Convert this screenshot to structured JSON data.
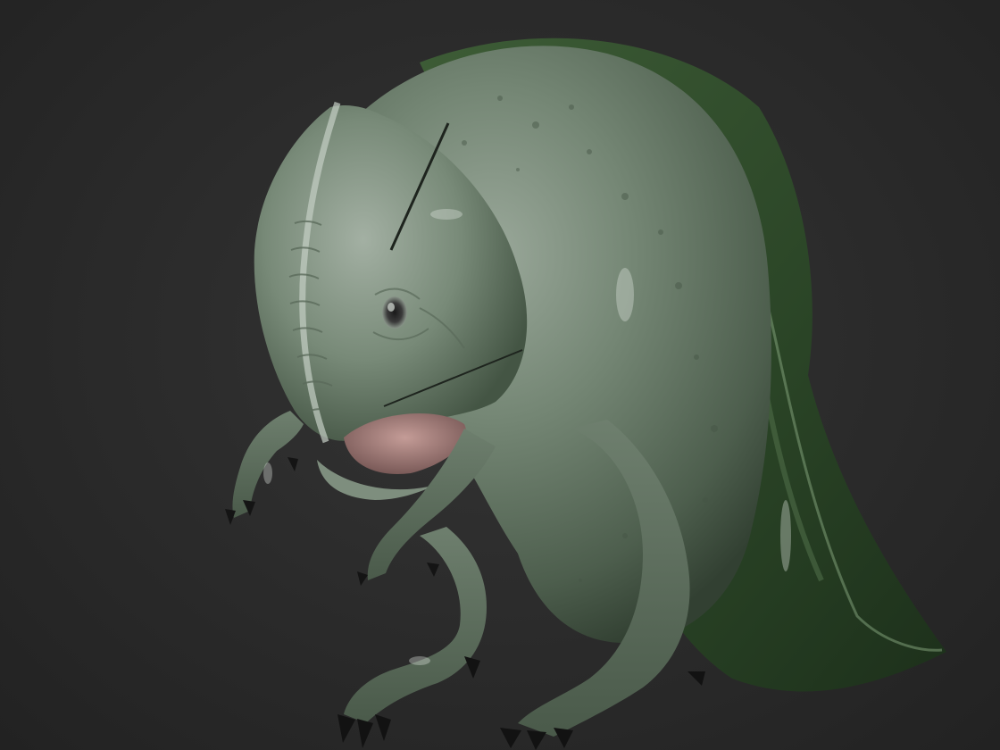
{
  "colors": {
    "background": "#2a2a2a",
    "skin_light": "#8f9d8f",
    "skin_mid": "#6f806f",
    "skin_dark": "#3f4f3f",
    "fin_green": "#2f4a2a",
    "mouth_pink": "#b08a86",
    "claw_black": "#141414"
  },
  "icons": {
    "creature": "amphibian-creature-render"
  }
}
